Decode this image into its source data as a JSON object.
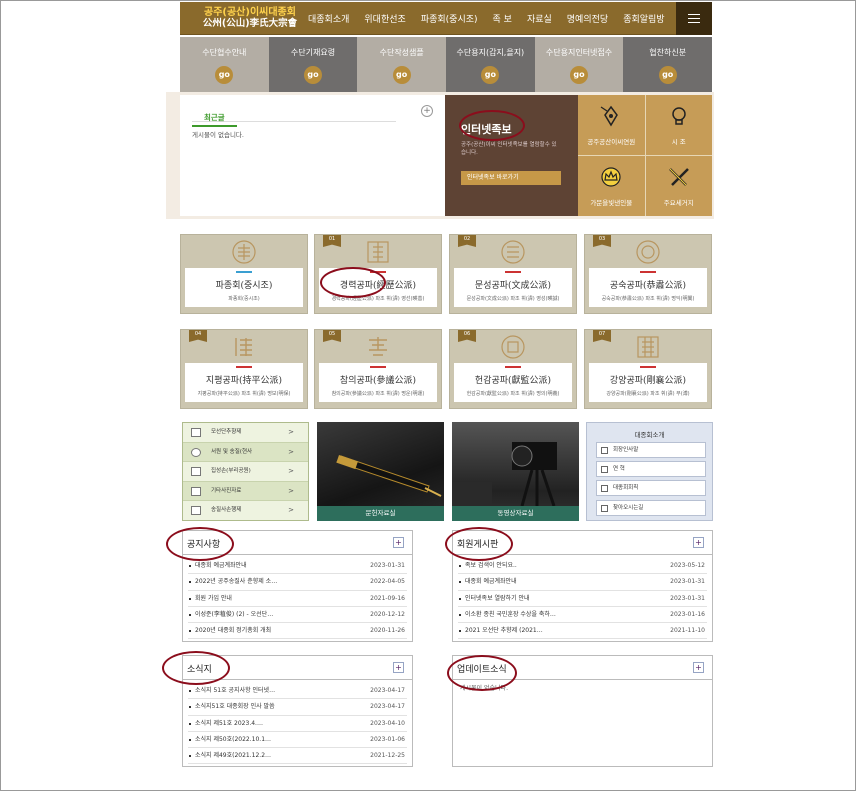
{
  "header": {
    "logo_line1": "공주(공산)이씨대종회",
    "logo_line2": "公州(公山)李氏大宗會",
    "nav": [
      "대종회소개",
      "위대한선조",
      "파종회(중시조)",
      "족 보",
      "자료실",
      "명예의전당",
      "종회알림방"
    ]
  },
  "quick_tiles": [
    {
      "label": "수단협수안내",
      "go": "go",
      "bg": "#b3ada4"
    },
    {
      "label": "수단기재요령",
      "go": "go",
      "bg": "#6f6d6c"
    },
    {
      "label": "수단작성샘플",
      "go": "go",
      "bg": "#b3ada4"
    },
    {
      "label": "수단용지(갑지,을지)",
      "go": "go",
      "bg": "#6f6d6c"
    },
    {
      "label": "수단용지인터넷접수",
      "go": "go",
      "bg": "#b3ada4"
    },
    {
      "label": "협찬하신분",
      "go": "go",
      "bg": "#6f6d6c"
    }
  ],
  "recent": {
    "tab": "최근글",
    "plus": "+",
    "empty": "게시물이 없습니다."
  },
  "net": {
    "title": "인터넷족보",
    "desc": "공주(공산)이씨 인터넷족보를 열람할수 있습니다.",
    "button": "인터넷족보 바로가기"
  },
  "grid4": [
    "공주공산이씨연원",
    "시 조",
    "가문을빛낸인물",
    "주요세거지"
  ],
  "branches": [
    {
      "num": "",
      "name": "파종회(중시조)",
      "sub": "파종회(중시조)"
    },
    {
      "num": "01",
      "name": "경력공파(經歷公派)",
      "sub": "경력공파(經歷公派) 파조 휘(諱) 영선(暎善)"
    },
    {
      "num": "02",
      "name": "문성공파(文成公派)",
      "sub": "문성공파(文成公派) 파조 휘(諱) 영성(暎誠)"
    },
    {
      "num": "03",
      "name": "공숙공파(恭肅公派)",
      "sub": "공숙공파(恭肅公派) 파조 휘(諱) 명익(明翼)"
    },
    {
      "num": "04",
      "name": "지평공파(持平公派)",
      "sub": "지평공파(持平公派) 파조 휘(諱) 명보(明保)"
    },
    {
      "num": "05",
      "name": "참의공파(參議公派)",
      "sub": "참의공파(參議公派) 파조 휘(諱) 명운(明運)"
    },
    {
      "num": "06",
      "name": "헌감공파(獻監公派)",
      "sub": "헌감공파(獻監公派) 파조 휘(諱) 명의(明義)"
    },
    {
      "num": "07",
      "name": "강양공파(剛襄公派)",
      "sub": "강양공파(剛襄公派) 파조 휘(諱) 부(溥)"
    }
  ],
  "links": [
    "모선단추향제",
    "서원 및 송질(현사",
    "집성손(부리공원)",
    "기타사진자료",
    "송질사손행제"
  ],
  "photos": [
    "문헌자료실",
    "동영상자료실"
  ],
  "about": {
    "title": "대종회소개",
    "items": [
      "회장인사말",
      "연 혁",
      "대종회회칙",
      "찾아오시는길"
    ]
  },
  "notice": {
    "title": "공지사항",
    "items": [
      {
        "t": "대종회 예금계좌안내",
        "d": "2023-01-31"
      },
      {
        "t": "2022년 공주송질사 춘향제 소…",
        "d": "2022-04-05"
      },
      {
        "t": "회원 가입 안내",
        "d": "2021-09-16"
      },
      {
        "t": "이성준(李稙俊) (2) - 오선단…",
        "d": "2020-12-12"
      },
      {
        "t": "2020년 대종회 정기총회 개최",
        "d": "2020-11-26"
      }
    ]
  },
  "member": {
    "title": "회원게시판",
    "items": [
      {
        "t": "족보 검색이 안되요..",
        "d": "2023-05-12"
      },
      {
        "t": "대종회 예금계좌안내",
        "d": "2023-01-31"
      },
      {
        "t": "인터넷족보 열람하기 안내",
        "d": "2023-01-31"
      },
      {
        "t": "이소환 종친 국민훈장 수상을 축하…",
        "d": "2023-01-16"
      },
      {
        "t": "2021 오선단 추향제 (2021…",
        "d": "2021-11-10"
      }
    ]
  },
  "news": {
    "title": "소식지",
    "items": [
      {
        "t": "소식지 51호 공지사항 인터넷…",
        "d": "2023-04-17"
      },
      {
        "t": "소식지51호 대종회장 인사 말씀",
        "d": "2023-04-17"
      },
      {
        "t": "소식지 제51호 2023.4.…",
        "d": "2023-04-10"
      },
      {
        "t": "소식지 제50호(2022.10.1…",
        "d": "2023-01-06"
      },
      {
        "t": "소식지 제49호(2021.12.2…",
        "d": "2021-12-25"
      }
    ]
  },
  "update": {
    "title": "업데이트소식",
    "empty": "게시물이 없습니다."
  },
  "plus": "+"
}
